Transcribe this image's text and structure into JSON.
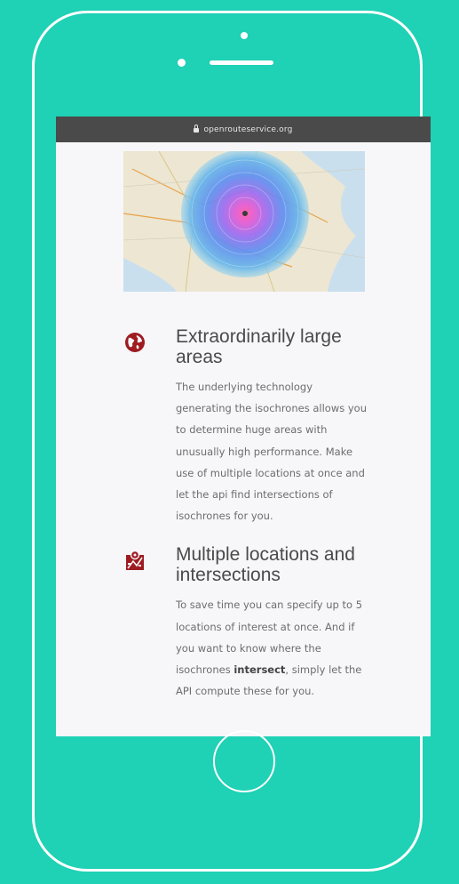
{
  "browser": {
    "url": "openrouteservice.org"
  },
  "colors": {
    "background": "#1fd1b5",
    "icon": "#9e1b22",
    "text": "#4a4a4a"
  },
  "features": [
    {
      "icon": "globe-icon",
      "title": "Extraordinarily large areas",
      "description": "The underlying technology generating the isochrones allows you to determine huge areas with unusually high performance. Make use of multiple locations at once and let the api find intersections of isochrones for you."
    },
    {
      "icon": "map-pin-icon",
      "title": "Multiple locations and intersections",
      "description_before": "To save time you can specify up to 5 locations of interest at once. And if you want to know where the isochrones ",
      "description_bold": "intersect",
      "description_after": ", simply let the API compute these for you."
    }
  ]
}
